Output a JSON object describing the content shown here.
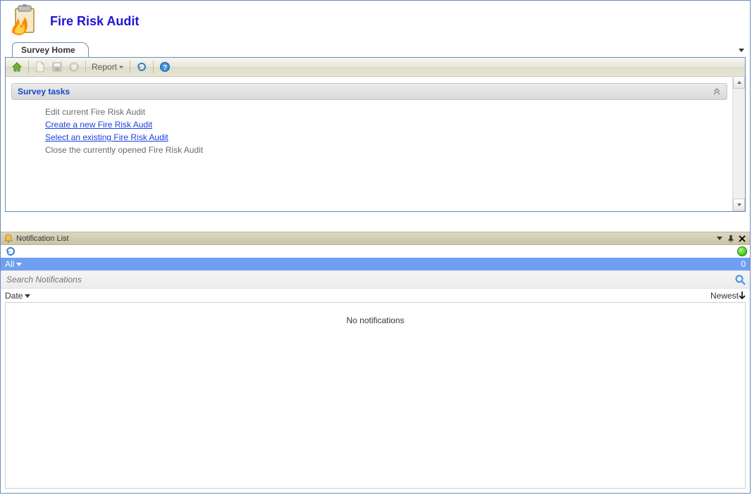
{
  "header": {
    "title": "Fire Risk Audit"
  },
  "tabs": {
    "active": "Survey Home"
  },
  "toolbar": {
    "report_label": "Report"
  },
  "tasks": {
    "panel_title": "Survey tasks",
    "items": [
      {
        "label": "Edit current Fire Risk Audit",
        "link": false
      },
      {
        "label": "Create a new Fire Risk Audit",
        "link": true
      },
      {
        "label": "Select an existing Fire Risk Audit",
        "link": true
      },
      {
        "label": "Close the currently opened Fire Risk Audit",
        "link": false
      }
    ]
  },
  "notifications": {
    "panel_title": "Notification List",
    "filter_label": "All",
    "count": "0",
    "search_placeholder": "Search Notifications",
    "sort_field": "Date",
    "sort_order": "Newest",
    "empty_text": "No notifications"
  }
}
